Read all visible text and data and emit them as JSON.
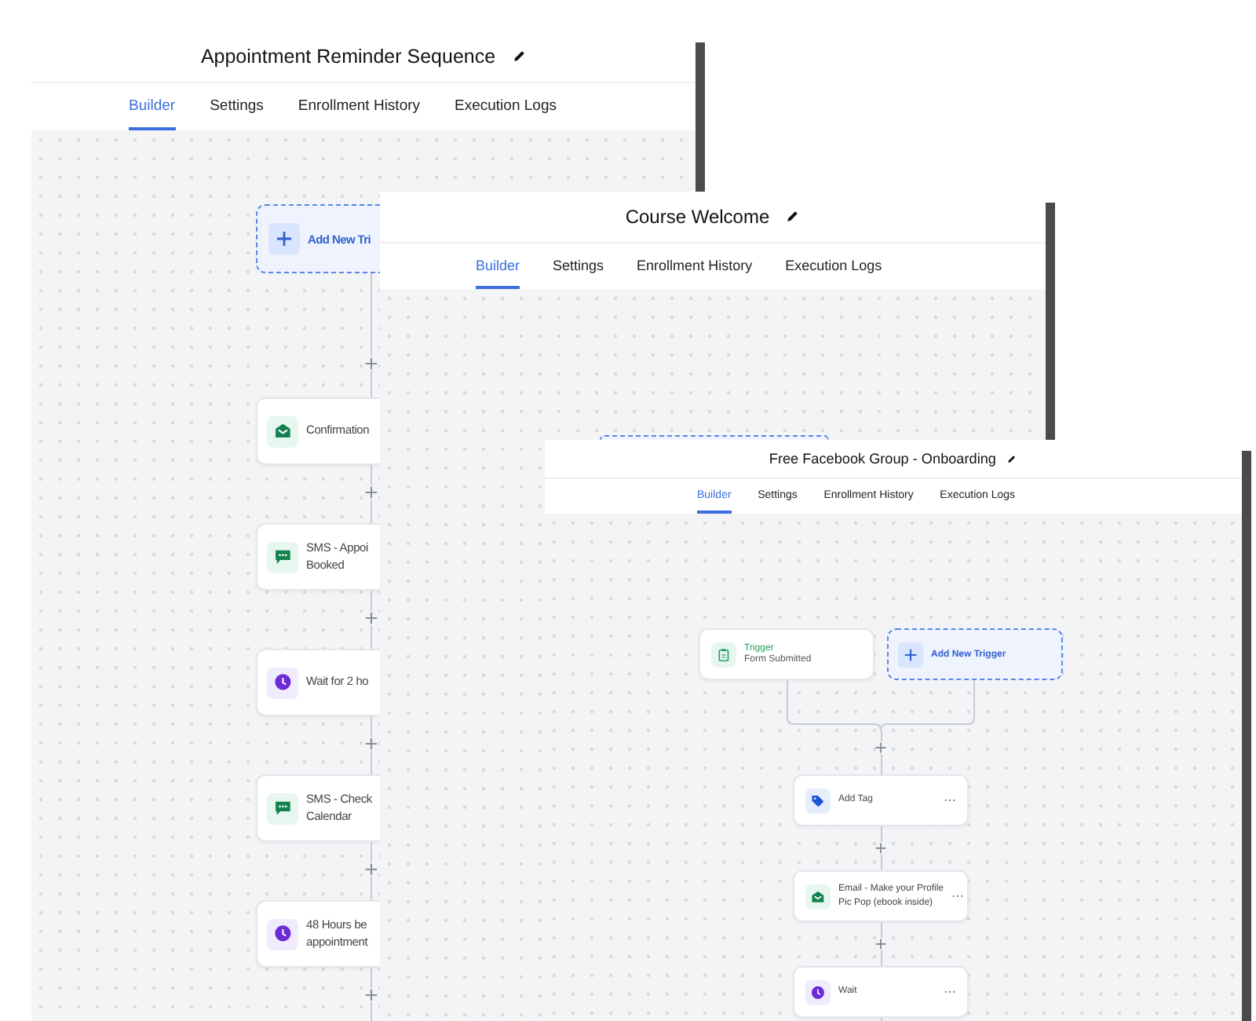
{
  "windows": [
    {
      "title": "Appointment Reminder Sequence",
      "tabs": [
        {
          "label": "Builder",
          "selected": true
        },
        {
          "label": "Settings",
          "selected": false
        },
        {
          "label": "Enrollment History",
          "selected": false
        },
        {
          "label": "Execution Logs",
          "selected": false
        }
      ],
      "triggers": [
        {
          "kind": "add",
          "label": "Add New Tri"
        }
      ],
      "steps": [
        {
          "kind": "email",
          "lines": [
            "Confirmation"
          ]
        },
        {
          "kind": "sms",
          "lines": [
            "SMS - Appoi",
            "Booked"
          ]
        },
        {
          "kind": "wait",
          "lines": [
            "Wait for 2 ho"
          ]
        },
        {
          "kind": "sms",
          "lines": [
            "SMS - Check",
            "Calendar"
          ]
        },
        {
          "kind": "wait",
          "lines": [
            "48 Hours be",
            "appointment"
          ]
        }
      ]
    },
    {
      "title": "Course Welcome",
      "tabs": [
        {
          "label": "Builder",
          "selected": true
        },
        {
          "label": "Settings",
          "selected": false
        },
        {
          "label": "Enrollment History",
          "selected": false
        },
        {
          "label": "Execution Logs",
          "selected": false
        }
      ],
      "triggers": [
        {
          "kind": "add"
        }
      ]
    },
    {
      "title": "Free Facebook Group - Onboarding",
      "tabs": [
        {
          "label": "Builder",
          "selected": true
        },
        {
          "label": "Settings",
          "selected": false
        },
        {
          "label": "Enrollment History",
          "selected": false
        },
        {
          "label": "Execution Logs",
          "selected": false
        }
      ],
      "triggers": [
        {
          "kind": "form",
          "title": "Trigger",
          "subtitle": "Form Submitted"
        },
        {
          "kind": "add",
          "label": "Add New Trigger"
        }
      ],
      "steps": [
        {
          "kind": "tag",
          "lines": [
            "Add Tag"
          ],
          "menu": true
        },
        {
          "kind": "email",
          "lines": [
            "Email - Make your Profile",
            "Pic Pop (ebook inside)"
          ],
          "menu": true
        },
        {
          "kind": "wait",
          "lines": [
            "Wait"
          ],
          "menu": true
        }
      ]
    }
  ]
}
